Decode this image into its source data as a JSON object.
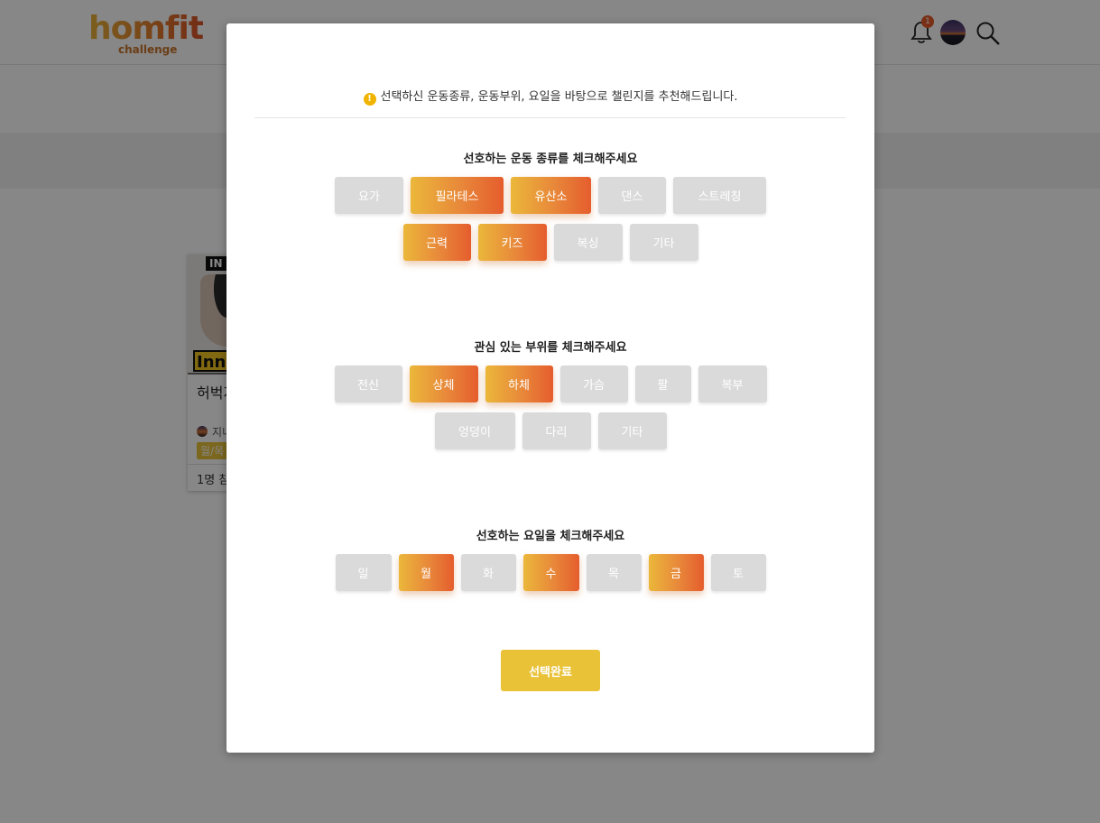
{
  "header": {
    "logo_main": "homfit",
    "logo_sub": "challenge",
    "notification_count": "1"
  },
  "card": {
    "image_tag": "IN",
    "image_caption": "Inne",
    "title": "허벅지",
    "user": "지니",
    "days": "월/목",
    "footer": "1명 참"
  },
  "modal": {
    "notice": "선택하신 운동종류, 운동부위, 요일을 바탕으로 챌린지를 추천해드립니다.",
    "notice_icon": "!",
    "sections": [
      {
        "title": "선호하는 운동 종류를 체크해주세요",
        "rows": [
          [
            {
              "label": "요가",
              "selected": false
            },
            {
              "label": "필라테스",
              "selected": true
            },
            {
              "label": "유산소",
              "selected": true
            },
            {
              "label": "댄스",
              "selected": false
            },
            {
              "label": "스트레칭",
              "selected": false
            }
          ],
          [
            {
              "label": "근력",
              "selected": true
            },
            {
              "label": "키즈",
              "selected": true
            },
            {
              "label": "복싱",
              "selected": false
            },
            {
              "label": "기타",
              "selected": false
            }
          ]
        ]
      },
      {
        "title": "관심 있는 부위를 체크해주세요",
        "rows": [
          [
            {
              "label": "전신",
              "selected": false
            },
            {
              "label": "상체",
              "selected": true
            },
            {
              "label": "하체",
              "selected": true
            },
            {
              "label": "가슴",
              "selected": false
            },
            {
              "label": "팔",
              "selected": false
            },
            {
              "label": "복부",
              "selected": false
            }
          ],
          [
            {
              "label": "엉덩이",
              "selected": false
            },
            {
              "label": "다리",
              "selected": false
            },
            {
              "label": "기타",
              "selected": false
            }
          ]
        ]
      },
      {
        "title": "선호하는 요일을 체크해주세요",
        "rows": [
          [
            {
              "label": "일",
              "selected": false
            },
            {
              "label": "월",
              "selected": true
            },
            {
              "label": "화",
              "selected": false
            },
            {
              "label": "수",
              "selected": true
            },
            {
              "label": "목",
              "selected": false
            },
            {
              "label": "금",
              "selected": true
            },
            {
              "label": "토",
              "selected": false
            }
          ]
        ]
      }
    ],
    "submit_label": "선택완료"
  },
  "colors": {
    "accent_start": "#ebb73a",
    "accent_end": "#e55d2d",
    "submit": "#e9c238",
    "chip_off": "#dadada"
  }
}
